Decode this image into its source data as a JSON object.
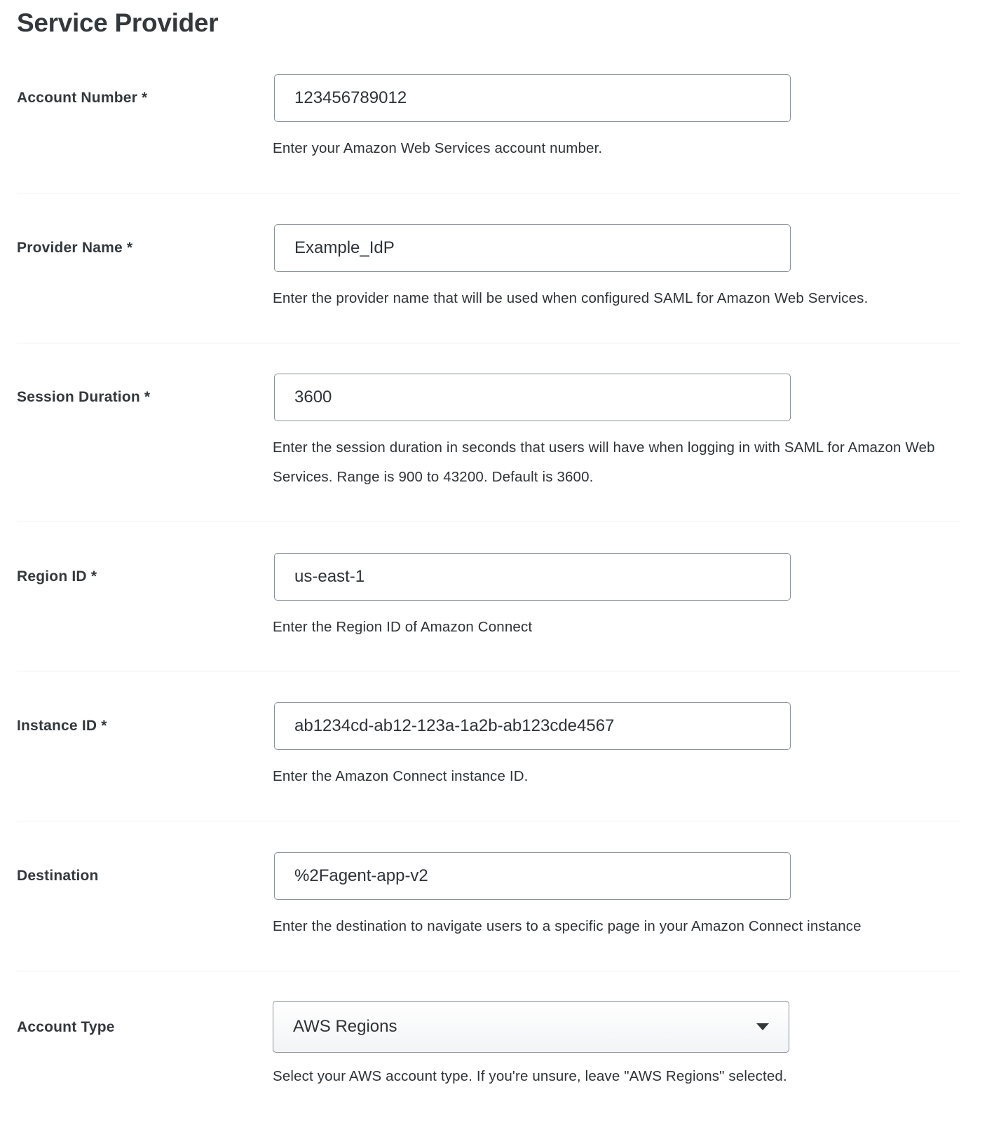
{
  "page": {
    "title": "Service Provider"
  },
  "fields": [
    {
      "label": "Account Number *",
      "value": "123456789012",
      "help": "Enter your Amazon Web Services account number."
    },
    {
      "label": "Provider Name *",
      "value": "Example_IdP",
      "help": "Enter the provider name that will be used when configured SAML for Amazon Web Services."
    },
    {
      "label": "Session Duration *",
      "value": "3600",
      "help": "Enter the session duration in seconds that users will have when logging in with SAML for Amazon Web Services. Range is 900 to 43200. Default is 3600."
    },
    {
      "label": "Region ID *",
      "value": "us-east-1",
      "help": "Enter the Region ID of Amazon Connect"
    },
    {
      "label": "Instance ID *",
      "value": "ab1234cd-ab12-123a-1a2b-ab123cde4567",
      "help": "Enter the Amazon Connect instance ID."
    },
    {
      "label": "Destination",
      "value": "%2Fagent-app-v2",
      "help": "Enter the destination to navigate users to a specific page in your Amazon Connect instance"
    }
  ],
  "account_type": {
    "label": "Account Type",
    "selected": "AWS Regions",
    "icon": "caret-down-icon",
    "help": "Select your AWS account type. If you're unsure, leave \"AWS Regions\" selected."
  }
}
